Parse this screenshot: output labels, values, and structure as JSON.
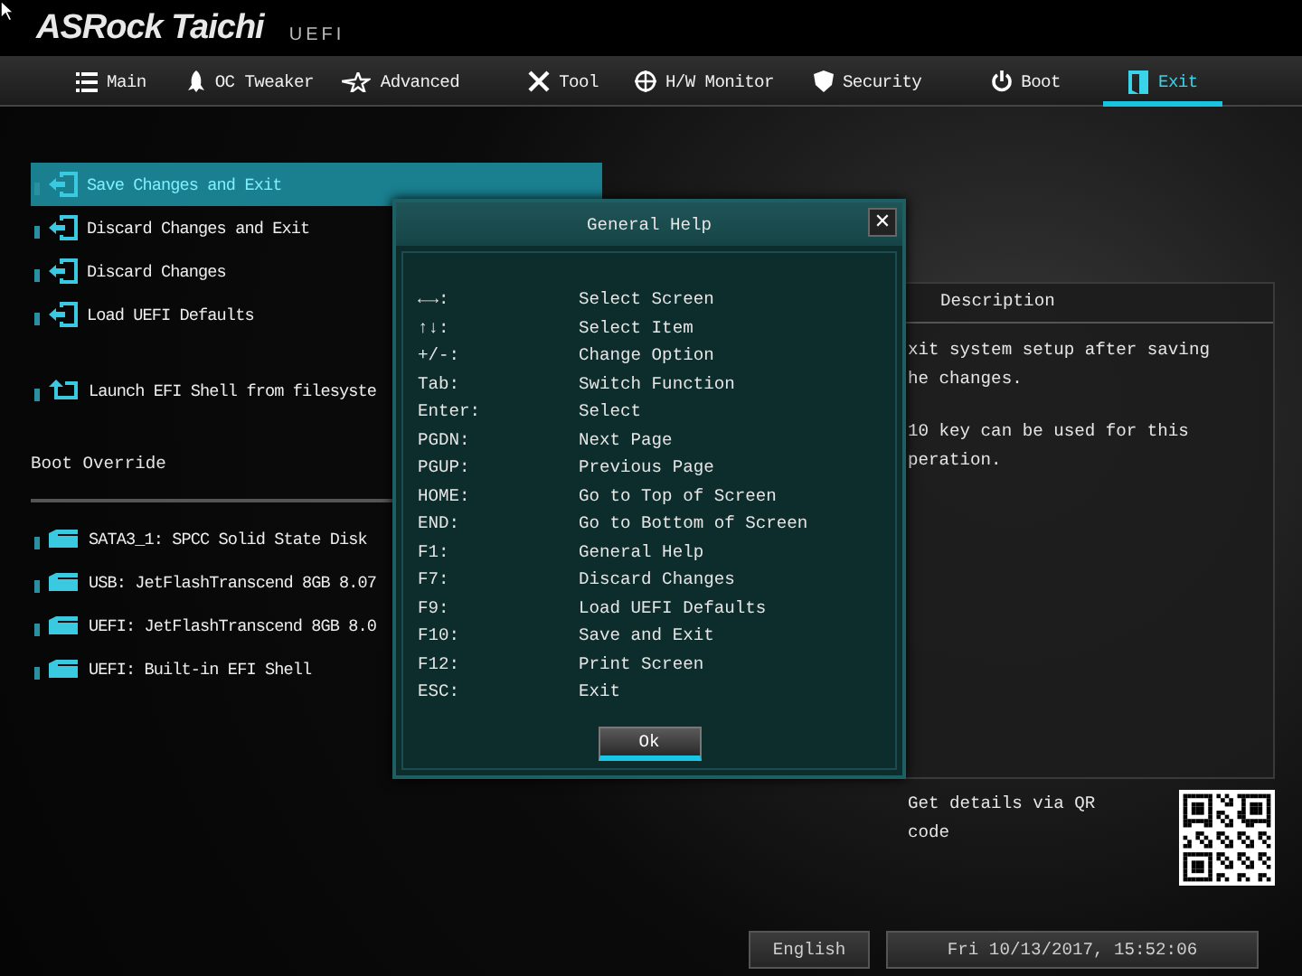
{
  "header": {
    "brand": "ASRock Taichi",
    "badge": "UEFI"
  },
  "tabs": [
    {
      "label": "Main",
      "selected": false
    },
    {
      "label": "OC Tweaker",
      "selected": false
    },
    {
      "label": "Advanced",
      "selected": false
    },
    {
      "label": "Tool",
      "selected": false
    },
    {
      "label": "H/W Monitor",
      "selected": false
    },
    {
      "label": "Security",
      "selected": false
    },
    {
      "label": "Boot",
      "selected": false
    },
    {
      "label": "Exit",
      "selected": true
    }
  ],
  "menu": [
    {
      "items": [
        {
          "label": "Save Changes and Exit",
          "kind": "exit",
          "selected": true
        },
        {
          "label": "Discard Changes and Exit",
          "kind": "exit",
          "selected": false
        },
        {
          "label": "Discard Changes",
          "kind": "exit",
          "selected": false
        },
        {
          "label": "Load UEFI Defaults",
          "kind": "exit",
          "selected": false
        }
      ]
    },
    {
      "items": [
        {
          "label": "Launch EFI Shell from filesyste",
          "kind": "shell",
          "selected": false
        }
      ]
    },
    {
      "title": "Boot Override",
      "items": [
        {
          "label": "SATA3_1: SPCC Solid State Disk",
          "kind": "drive",
          "selected": false
        },
        {
          "label": "USB: JetFlashTranscend 8GB 8.07",
          "kind": "drive",
          "selected": false
        },
        {
          "label": "UEFI: JetFlashTranscend 8GB 8.0",
          "kind": "drive",
          "selected": false
        },
        {
          "label": "UEFI: Built-in EFI Shell",
          "kind": "drive",
          "selected": false
        }
      ]
    }
  ],
  "help_dialog": {
    "title": "General Help",
    "close": "✕",
    "rows": [
      {
        "key": "←→:",
        "action": "Select Screen"
      },
      {
        "key": "↑↓:",
        "action": "Select Item"
      },
      {
        "key": "+/-:",
        "action": "Change Option"
      },
      {
        "key": "Tab:",
        "action": "Switch Function"
      },
      {
        "key": "Enter:",
        "action": "Select"
      },
      {
        "key": "PGDN:",
        "action": "Next Page"
      },
      {
        "key": "PGUP:",
        "action": "Previous Page"
      },
      {
        "key": "HOME:",
        "action": "Go to Top of Screen"
      },
      {
        "key": "END:",
        "action": "Go to Bottom of Screen"
      },
      {
        "key": "F1:",
        "action": "General Help"
      },
      {
        "key": "F7:",
        "action": "Discard Changes"
      },
      {
        "key": "F9:",
        "action": "Load UEFI Defaults"
      },
      {
        "key": "F10:",
        "action": "Save and Exit"
      },
      {
        "key": "F12:",
        "action": "Print Screen"
      },
      {
        "key": "ESC:",
        "action": "Exit"
      }
    ],
    "ok_button": "Ok"
  },
  "description": {
    "title": "Description",
    "paragraphs": [
      [
        "xit system setup after saving",
        "he changes."
      ],
      [
        "10 key can be used for this",
        "peration."
      ]
    ]
  },
  "qr": {
    "caption": "Get details via QR code"
  },
  "status_bar": {
    "language": "English",
    "datetime": "Fri 10/13/2017, 15:52:06"
  }
}
